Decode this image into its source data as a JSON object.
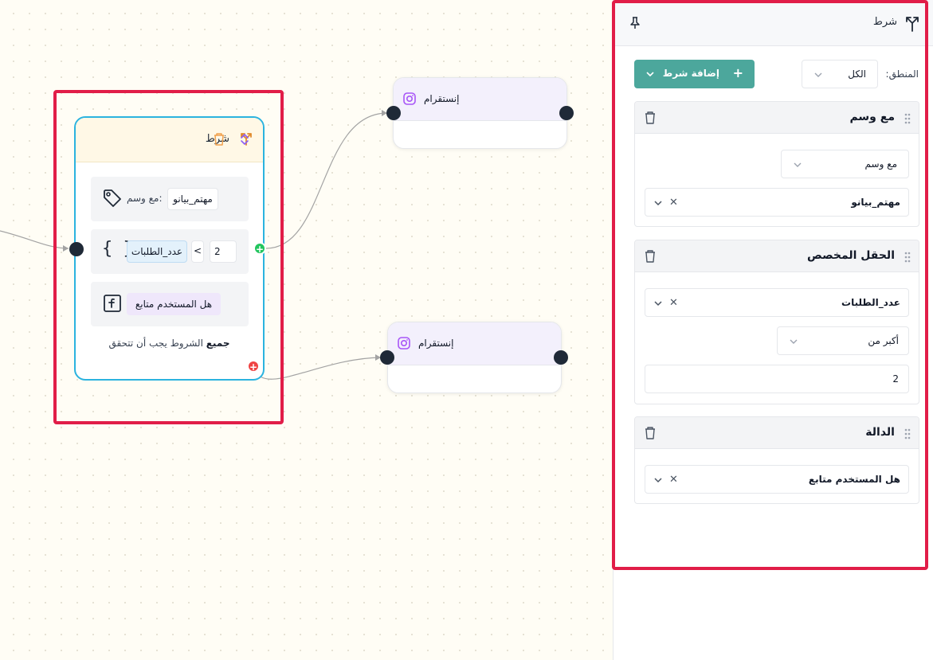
{
  "canvas": {
    "condition_node": {
      "title": "شرط",
      "rules": [
        {
          "label": "مع وسم:",
          "value": "مهتم_بيانو"
        },
        {
          "field": "عدد_الطلبات",
          "operator": "<",
          "value": "2"
        },
        {
          "function": "هل المستخدم متابع"
        }
      ],
      "footer_bold": "جميع",
      "footer_rest": " الشروط يجب أن تتحقق"
    },
    "instagram_nodes": [
      {
        "label": "إنستقرام"
      },
      {
        "label": "إنستقرام"
      }
    ],
    "true_handle": "+",
    "false_handle": "+"
  },
  "panel": {
    "title": "شرط",
    "logic_label": "المنطق:",
    "logic_value": "الكل",
    "add_button": "إضافة شرط",
    "cards": {
      "tag": {
        "title": "مع وسم",
        "type_value": "مع وسم",
        "tag_value": "مهتم_بيانو"
      },
      "custom_field": {
        "title": "الحقل المخصص",
        "field_value": "عدد_الطلبات",
        "operator_value": "أكبر من",
        "input_value": "2"
      },
      "function": {
        "title": "الدالة",
        "function_value": "هل المستخدم متابع"
      }
    }
  },
  "colors": {
    "highlight": "#e11d48",
    "accent": "#4ca79c",
    "node_border": "#2bb3df",
    "true_handle": "#22c55e",
    "false_handle": "#ef4444"
  }
}
